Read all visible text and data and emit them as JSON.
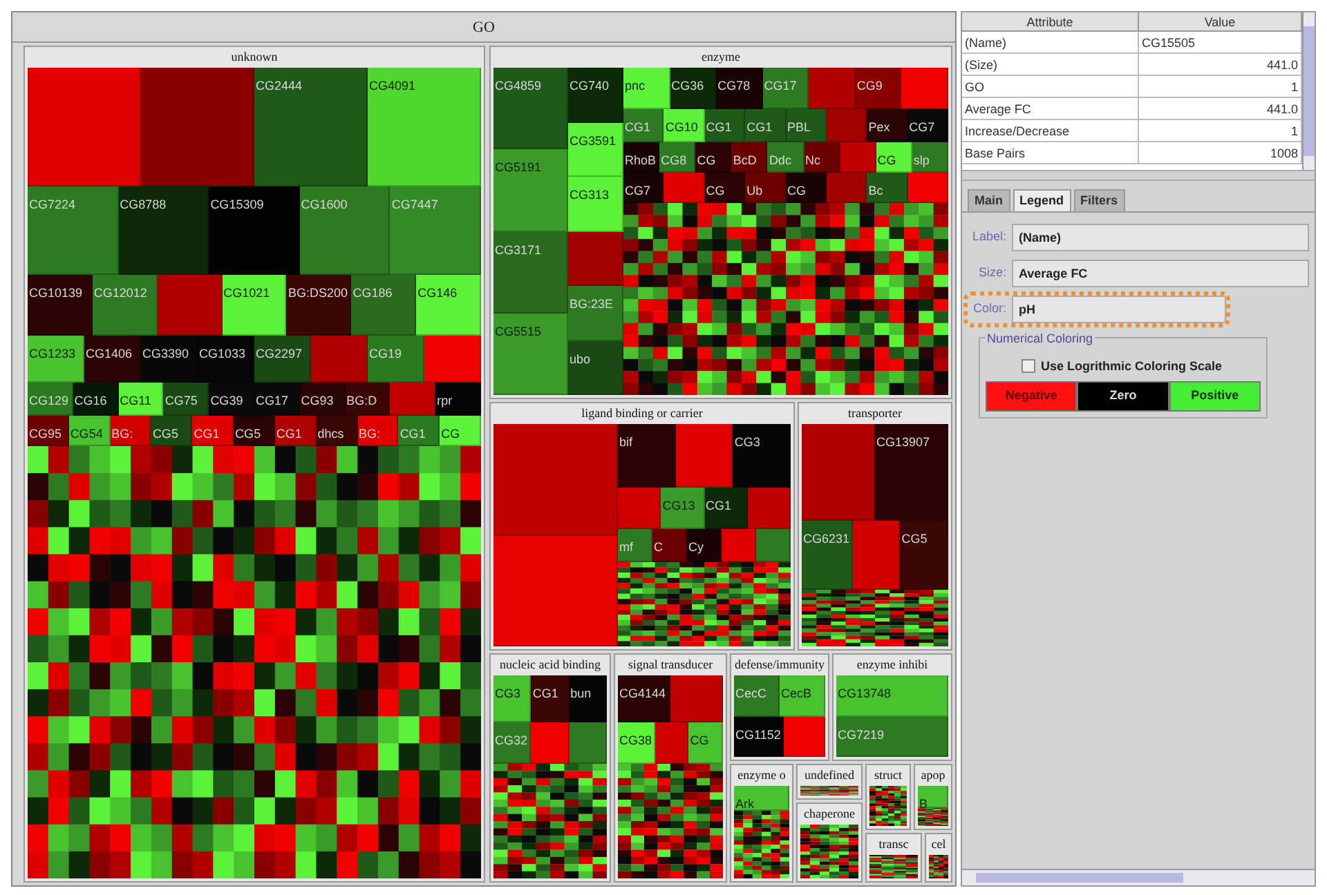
{
  "treemap": {
    "title": "GO",
    "sections": [
      {
        "title": "unknown",
        "mosaic": true,
        "strips": [
          {
            "tiles": [
              {
                "color": "#e00000"
              },
              {
                "color": "#8a0000"
              },
              {
                "label": "CG2444",
                "color": "#1f5a1a"
              },
              {
                "label": "CG4091",
                "color": "#4fd62f"
              }
            ]
          },
          {
            "tiles": [
              {
                "label": "CG7224",
                "color": "#2e7a22"
              },
              {
                "label": "CG8788",
                "color": "#0c2a08"
              },
              {
                "label": "CG15309",
                "color": "#020202"
              },
              {
                "label": "CG1600",
                "color": "#2e7a22"
              },
              {
                "label": "CG7447",
                "color": "#338a26"
              }
            ]
          },
          {
            "tiles": [
              {
                "label": "CG10139",
                "color": "#2a0404"
              },
              {
                "label": "CG12012",
                "color": "#2e7a22"
              },
              {
                "color": "#b00000"
              },
              {
                "label": "CG1021",
                "color": "#5cf23a"
              },
              {
                "label": "BG:DS200",
                "color": "#3a0606"
              },
              {
                "label": "CG186",
                "color": "#2a6a1e"
              },
              {
                "label": "CG146",
                "color": "#5cf23a"
              }
            ]
          },
          {
            "tiles": [
              {
                "label": "CG1233",
                "color": "#49c22f"
              },
              {
                "label": "CG1406",
                "color": "#2a0404"
              },
              {
                "label": "CG3390",
                "color": "#080808"
              },
              {
                "label": "CG1033",
                "color": "#060606"
              },
              {
                "label": "CG2297",
                "color": "#1a4a14"
              },
              {
                "color": "#b00000"
              },
              {
                "label": "CG19",
                "color": "#2a7a20"
              },
              {
                "color": "#f00000"
              }
            ]
          },
          {
            "tiles": [
              {
                "label": "CG129",
                "color": "#2a7a20"
              },
              {
                "label": "CG16",
                "color": "#061806"
              },
              {
                "label": "CG11",
                "color": "#5cf23a"
              },
              {
                "label": "CG75",
                "color": "#1a4a14"
              },
              {
                "label": "CG39",
                "color": "#0a0a0a"
              },
              {
                "label": "CG17",
                "color": "#0a0a0a"
              },
              {
                "label": "CG93",
                "color": "#2a0404"
              },
              {
                "label": "BG:D",
                "color": "#3a0606"
              },
              {
                "color": "#c00000"
              },
              {
                "label": "rpr",
                "color": "#050505"
              }
            ]
          },
          {
            "tiles": [
              {
                "label": "CG95",
                "color": "#6a0000"
              },
              {
                "label": "CG54",
                "color": "#49c22f"
              },
              {
                "label": "BG:",
                "color": "#d00000"
              },
              {
                "label": "CG5",
                "color": "#1a4a14"
              },
              {
                "label": "CG1",
                "color": "#e00000"
              },
              {
                "label": "CG5",
                "color": "#2a0404"
              },
              {
                "label": "CG1",
                "color": "#b00000"
              },
              {
                "label": "dhcs",
                "color": "#3a0606"
              },
              {
                "label": "BG:",
                "color": "#e00000"
              },
              {
                "label": "CG1",
                "color": "#2a7a20"
              },
              {
                "label": "CG",
                "color": "#5cf23a"
              }
            ]
          }
        ]
      },
      {
        "title": "enzyme",
        "mosaic": true,
        "stacks": [
          {
            "tiles": [
              {
                "label": "CG4859",
                "color": "#1f5a1a"
              },
              {
                "label": "CG5191",
                "color": "#3a9a2a"
              },
              {
                "label": "CG3171",
                "color": "#2a6a1e"
              },
              {
                "label": "CG5515",
                "color": "#3a9a2a"
              }
            ]
          },
          {
            "tiles": [
              {
                "label": "CG740",
                "color": "#0c2a08"
              },
              {
                "label": "CG3591",
                "color": "#5cf23a"
              },
              {
                "label": "CG313",
                "color": "#5cf23a"
              },
              {
                "color": "#a00000"
              },
              {
                "label": "BG:23E",
                "color": "#2e7a22"
              },
              {
                "label": "ubo",
                "color": "#1a4a14"
              }
            ]
          }
        ],
        "strips": [
          {
            "tiles": [
              {
                "label": "pnc",
                "color": "#5cf23a"
              },
              {
                "label": "CG36",
                "color": "#0c2a08"
              },
              {
                "label": "CG78",
                "color": "#1a0303"
              },
              {
                "label": "CG17",
                "color": "#2e7a22"
              },
              {
                "color": "#b00000"
              },
              {
                "label": "CG9",
                "color": "#8a0000"
              },
              {
                "color": "#f00000"
              }
            ]
          },
          {
            "tiles": [
              {
                "label": "CG1",
                "color": "#2e7a22"
              },
              {
                "label": "CG10",
                "color": "#5cf23a"
              },
              {
                "label": "CG1",
                "color": "#1f5a1a"
              },
              {
                "label": "CG1",
                "color": "#1f5a1a"
              },
              {
                "label": "PBL",
                "color": "#1f5a1a"
              },
              {
                "color": "#a00000"
              },
              {
                "label": "Pex",
                "color": "#2a0404"
              },
              {
                "label": "CG7",
                "color": "#0a0a0a"
              }
            ]
          },
          {
            "tiles": [
              {
                "label": "RhoB",
                "color": "#1a0303"
              },
              {
                "label": "CG8",
                "color": "#2e7a22"
              },
              {
                "label": "CG",
                "color": "#2a0404"
              },
              {
                "label": "BcD",
                "color": "#6a0000"
              },
              {
                "label": "Ddc",
                "color": "#2e7a22"
              },
              {
                "label": "Nc",
                "color": "#6a0000"
              },
              {
                "color": "#c00000"
              },
              {
                "label": "CG",
                "color": "#5cf23a"
              },
              {
                "label": "slp",
                "color": "#2e7a22"
              }
            ]
          },
          {
            "tiles": [
              {
                "label": "CG7",
                "color": "#1a0303"
              },
              {
                "color": "#e00000"
              },
              {
                "label": "CG",
                "color": "#2a0404"
              },
              {
                "label": "Ub",
                "color": "#6a0000"
              },
              {
                "label": "CG",
                "color": "#1a0303"
              },
              {
                "color": "#a00000"
              },
              {
                "label": "Bc",
                "color": "#1f5a1a"
              },
              {
                "color": "#f00000"
              }
            ]
          }
        ]
      },
      {
        "title": "ligand binding or carrier",
        "mosaic": true,
        "stacks": [
          {
            "tiles": [
              {
                "color": "#c00000"
              },
              {
                "color": "#e80000"
              }
            ]
          }
        ],
        "strips": [
          {
            "tiles": [
              {
                "label": "bif",
                "color": "#2a0404"
              },
              {
                "color": "#e00000"
              },
              {
                "label": "CG3",
                "color": "#050505"
              }
            ]
          },
          {
            "tiles": [
              {
                "color": "#d00000"
              },
              {
                "label": "CG13",
                "color": "#3a9a2a"
              },
              {
                "label": "CG1",
                "color": "#0c2a08"
              },
              {
                "color": "#c00000"
              }
            ]
          },
          {
            "tiles": [
              {
                "label": "mf",
                "color": "#2e7a22"
              },
              {
                "label": "C",
                "color": "#6a0000"
              },
              {
                "label": "Cy",
                "color": "#1a0303"
              },
              {
                "color": "#e00000"
              },
              {
                "color": "#2e7a22"
              }
            ]
          }
        ]
      },
      {
        "title": "transporter",
        "mosaic": true,
        "strips": [
          {
            "tiles": [
              {
                "color": "#b00000"
              },
              {
                "label": "CG13907",
                "color": "#2a0404"
              }
            ]
          },
          {
            "tiles": [
              {
                "label": "CG6231",
                "color": "#1f5a1a"
              },
              {
                "color": "#d00000"
              },
              {
                "label": "CG5",
                "color": "#3a0606"
              }
            ]
          }
        ]
      },
      {
        "title": "nucleic acid binding",
        "mosaic": true,
        "strips": [
          {
            "tiles": [
              {
                "label": "CG3",
                "color": "#49c22f"
              },
              {
                "label": "CG1",
                "color": "#3a0606"
              },
              {
                "label": "bun",
                "color": "#050505"
              }
            ]
          },
          {
            "tiles": [
              {
                "label": "CG32",
                "color": "#2e7a22"
              },
              {
                "color": "#f00000"
              },
              {
                "color": "#2e7a22"
              }
            ]
          }
        ]
      },
      {
        "title": "signal transducer",
        "mosaic": true,
        "strips": [
          {
            "tiles": [
              {
                "label": "CG4144",
                "color": "#2a0404"
              },
              {
                "color": "#c00000"
              }
            ]
          },
          {
            "tiles": [
              {
                "label": "CG38",
                "color": "#5cf23a"
              },
              {
                "color": "#d00000"
              },
              {
                "label": "CG",
                "color": "#49c22f"
              }
            ]
          }
        ]
      },
      {
        "title": "defense/immunity",
        "strips": [
          {
            "tiles": [
              {
                "label": "CecC",
                "color": "#2e7a22"
              },
              {
                "label": "CecB",
                "color": "#49c22f"
              }
            ]
          },
          {
            "tiles": [
              {
                "label": "CG1152",
                "color": "#050505"
              },
              {
                "color": "#f00000"
              }
            ]
          }
        ]
      },
      {
        "title": "enzyme inhibi",
        "strips": [
          {
            "tiles": [
              {
                "label": "CG13748",
                "color": "#49c22f"
              }
            ]
          },
          {
            "tiles": [
              {
                "label": "CG7219",
                "color": "#2e7a22"
              }
            ]
          }
        ]
      },
      {
        "title": "enzyme o",
        "mosaic": true,
        "strips": [
          {
            "tiles": [
              {
                "label": "Ark",
                "color": "#49c22f"
              }
            ]
          }
        ]
      },
      {
        "title": "undefined",
        "mosaic": true
      },
      {
        "title": "struct",
        "mosaic": true
      },
      {
        "title": "apop",
        "mosaic": true,
        "strips": [
          {
            "tiles": [
              {
                "label": "B",
                "color": "#49c22f"
              }
            ]
          }
        ]
      },
      {
        "title": "chaperone",
        "mosaic": true
      },
      {
        "title": "transc",
        "mosaic": true
      },
      {
        "title": "cel",
        "mosaic": true
      }
    ]
  },
  "attributes": {
    "columns": [
      "Attribute",
      "Value"
    ],
    "rows": [
      [
        "(Name)",
        "CG15505"
      ],
      [
        "(Size)",
        "441.0"
      ],
      [
        "GO",
        "1"
      ],
      [
        "Average FC",
        "441.0"
      ],
      [
        "Increase/Decrease",
        "1"
      ],
      [
        "Base Pairs",
        "1008"
      ]
    ]
  },
  "tabs": [
    {
      "label": "Main",
      "selected": false
    },
    {
      "label": "Legend",
      "selected": true
    },
    {
      "label": "Filters",
      "selected": false
    }
  ],
  "legend": {
    "fields": [
      {
        "label": "Label:",
        "value": "(Name)",
        "highlighted": false
      },
      {
        "label": "Size:",
        "value": "Average FC",
        "highlighted": false
      },
      {
        "label": "Color:",
        "value": "pH",
        "highlighted": true
      }
    ],
    "group_title": "Numerical Coloring",
    "log_scale": {
      "label": "Use Logrithmic Coloring Scale",
      "checked": false
    },
    "scale_buttons": [
      {
        "label": "Negative",
        "color": "#ff1010"
      },
      {
        "label": "Zero",
        "color": "#000000"
      },
      {
        "label": "Positive",
        "color": "#44ee33"
      }
    ]
  }
}
